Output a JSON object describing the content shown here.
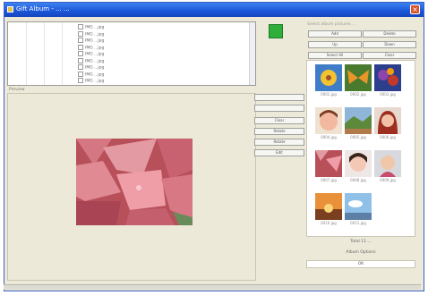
{
  "window": {
    "title": "Gift Album - ... ..."
  },
  "file_list": {
    "items": [
      "IMG ...jpg",
      "IMG ...jpg",
      "IMG ...jpg",
      "IMG ...jpg",
      "IMG ...jpg",
      "IMG ...jpg",
      "IMG ...jpg",
      "IMG ...jpg",
      "IMG ...jpg"
    ]
  },
  "viewer": {
    "label": "Preview"
  },
  "middle_buttons": [
    "",
    "",
    "Clear",
    "Rotate",
    "Rotate",
    "Edit"
  ],
  "right_panel": {
    "title": "Select album pictures ...",
    "buttons": [
      [
        "Add",
        "Delete"
      ],
      [
        "Up",
        "Down"
      ],
      [
        "Select All",
        "Clear"
      ]
    ]
  },
  "thumbnails": [
    {
      "caption": "0001.jpg",
      "subject": "flower-yellow"
    },
    {
      "caption": "0002.jpg",
      "subject": "butterfly"
    },
    {
      "caption": "0003.jpg",
      "subject": "flowers-purple"
    },
    {
      "caption": "0004.jpg",
      "subject": "face"
    },
    {
      "caption": "0005.jpg",
      "subject": "landscape"
    },
    {
      "caption": "0006.jpg",
      "subject": "portrait-red"
    },
    {
      "caption": "0007.jpg",
      "subject": "red-leaves"
    },
    {
      "caption": "0008.jpg",
      "subject": "girl"
    },
    {
      "caption": "0009.jpg",
      "subject": "woman"
    },
    {
      "caption": "0010.jpg",
      "subject": "sunset"
    },
    {
      "caption": "0011.jpg",
      "subject": "sky"
    }
  ],
  "info": {
    "line1": "Total 11 ...",
    "line2": "Album Options",
    "ok": "OK"
  },
  "colors": {
    "titlebar": "#1a55d8",
    "window_bg": "#ece9d8",
    "accent_green": "#2fae3a"
  },
  "icons": {
    "app": "app-icon",
    "close": "close-icon",
    "green": "picture-icon"
  }
}
